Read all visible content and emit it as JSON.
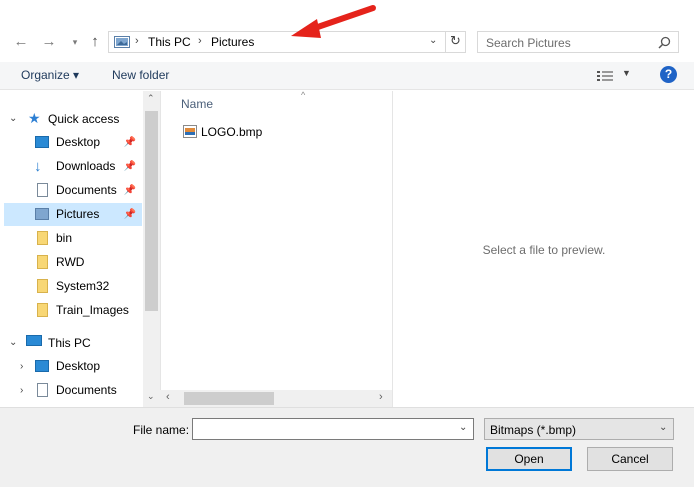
{
  "address": {
    "crumbs": [
      "This PC",
      "Pictures"
    ],
    "separator": "›"
  },
  "search": {
    "placeholder": "Search Pictures"
  },
  "toolbar": {
    "organize": "Organize ▾",
    "new_folder": "New folder"
  },
  "nav": {
    "quick_access": "Quick access",
    "items": [
      {
        "label": "Desktop",
        "pinned": true
      },
      {
        "label": "Downloads",
        "pinned": true
      },
      {
        "label": "Documents",
        "pinned": true
      },
      {
        "label": "Pictures",
        "pinned": true,
        "selected": true
      },
      {
        "label": "bin"
      },
      {
        "label": "RWD"
      },
      {
        "label": "System32"
      },
      {
        "label": "Train_Images"
      }
    ],
    "this_pc": "This PC",
    "pc_items": [
      "Desktop",
      "Documents"
    ]
  },
  "file_list": {
    "column_name": "Name",
    "files": [
      "LOGO.bmp"
    ]
  },
  "preview": {
    "message": "Select a file to preview."
  },
  "bottom": {
    "file_name_label": "File name:",
    "file_name_value": "",
    "file_type": "Bitmaps (*.bmp)",
    "open": "Open",
    "cancel": "Cancel"
  },
  "colors": {
    "accent": "#0078d7",
    "selected": "#cce8ff",
    "arrow": "#e5231b"
  }
}
